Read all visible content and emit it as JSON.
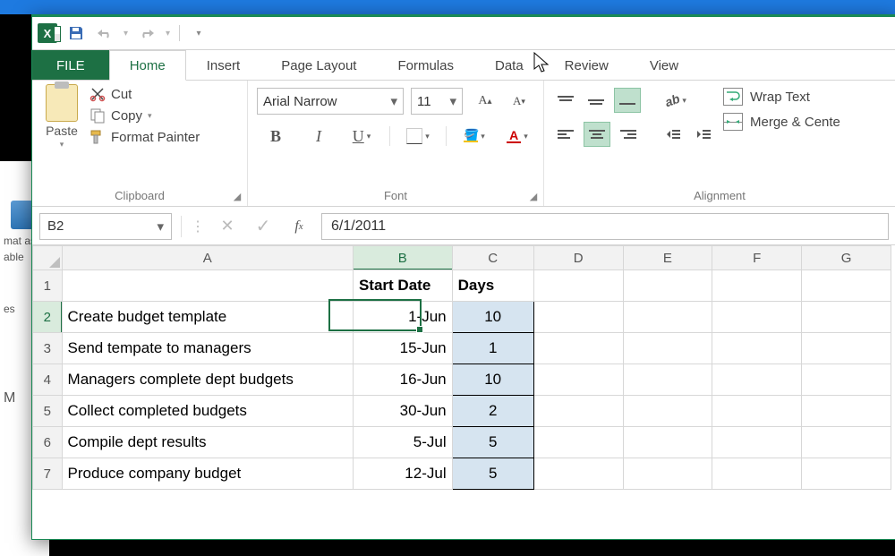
{
  "qat": {
    "save_tooltip": "Save",
    "undo_tooltip": "Undo",
    "redo_tooltip": "Redo"
  },
  "tabs": {
    "file": "FILE",
    "home": "Home",
    "insert": "Insert",
    "page_layout": "Page Layout",
    "formulas": "Formulas",
    "data": "Data",
    "review": "Review",
    "view": "View"
  },
  "ribbon": {
    "clipboard": {
      "paste": "Paste",
      "cut": "Cut",
      "copy": "Copy",
      "format_painter": "Format Painter",
      "title": "Clipboard"
    },
    "font": {
      "name": "Arial Narrow",
      "size": "11",
      "title": "Font"
    },
    "alignment": {
      "wrap_text": "Wrap Text",
      "merge_center": "Merge & Cente",
      "title": "Alignment"
    }
  },
  "namebox": "B2",
  "formula": "6/1/2011",
  "columns": [
    "A",
    "B",
    "C",
    "D",
    "E",
    "F",
    "G"
  ],
  "headers": {
    "b": "Start Date",
    "c": "Days"
  },
  "rows": [
    {
      "n": 1
    },
    {
      "n": 2,
      "a": "Create budget template",
      "b": "1-Jun",
      "c": "10"
    },
    {
      "n": 3,
      "a": "Send tempate to managers",
      "b": "15-Jun",
      "c": "1"
    },
    {
      "n": 4,
      "a": "Managers complete dept budgets",
      "b": "16-Jun",
      "c": "10"
    },
    {
      "n": 5,
      "a": "Collect completed budgets",
      "b": "30-Jun",
      "c": "2"
    },
    {
      "n": 6,
      "a": "Compile dept results",
      "b": "5-Jul",
      "c": "5"
    },
    {
      "n": 7,
      "a": "Produce company budget",
      "b": "12-Jul",
      "c": "5"
    }
  ],
  "bg": {
    "format_as": "mat as",
    "table": "able",
    "styles_trunc": "es",
    "m": "M"
  }
}
